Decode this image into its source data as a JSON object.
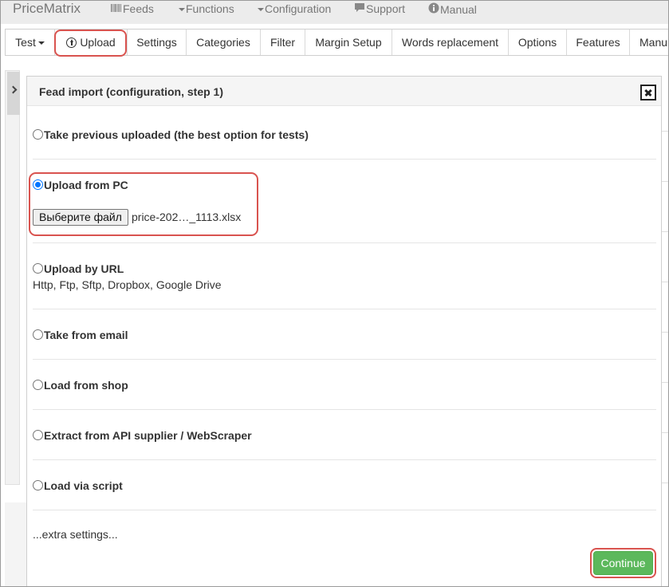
{
  "topnav": {
    "brand": "PriceMatrix",
    "items": [
      {
        "label": "Feeds",
        "icon": "barcode-icon"
      },
      {
        "label": "Functions",
        "icon": "caret-down-icon"
      },
      {
        "label": "Configuration",
        "icon": "caret-down-icon"
      },
      {
        "label": "Support",
        "icon": "chat-icon"
      },
      {
        "label": "Manual",
        "icon": "info-icon"
      }
    ]
  },
  "tabs": [
    {
      "label": "Test"
    },
    {
      "label": "Upload"
    },
    {
      "label": "Settings"
    },
    {
      "label": "Categories"
    },
    {
      "label": "Filter"
    },
    {
      "label": "Margin Setup"
    },
    {
      "label": "Words replacement"
    },
    {
      "label": "Options"
    },
    {
      "label": "Features"
    },
    {
      "label": "Manu"
    }
  ],
  "modal": {
    "title": "Fead import (configuration, step 1)",
    "options": [
      {
        "label": "Take previous uploaded (the best option for tests)",
        "checked": false
      },
      {
        "label": "Upload from PC",
        "checked": true
      },
      {
        "label": "Upload by URL",
        "checked": false,
        "sub": "Http, Ftp, Sftp, Dropbox, Google Drive"
      },
      {
        "label": "Take from email",
        "checked": false
      },
      {
        "label": "Load from shop",
        "checked": false
      },
      {
        "label": "Extract from API supplier / WebScraper",
        "checked": false
      },
      {
        "label": "Load via script",
        "checked": false
      }
    ],
    "file_button": "Выберите файл",
    "file_name": "price-202…_1113.xlsx",
    "extra_settings": "...extra settings...",
    "continue_label": "Continue"
  },
  "colors": {
    "highlight": "#d9534f",
    "continue": "#5cb85c",
    "radio_checked": "#0075ff"
  }
}
